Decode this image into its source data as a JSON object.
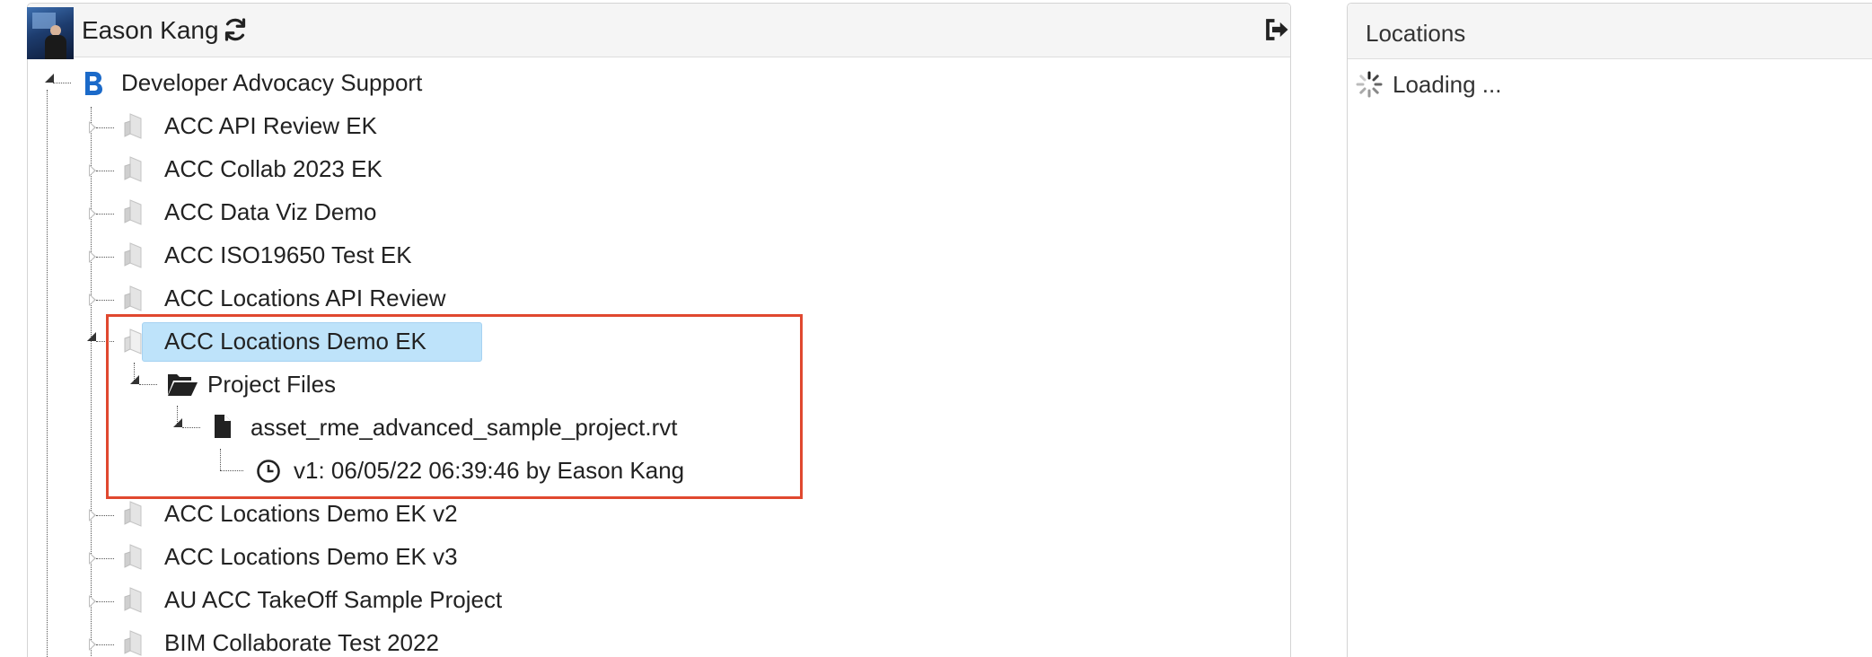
{
  "header": {
    "user_name": "Eason Kang",
    "refresh_icon": "refresh-icon",
    "signout_icon": "sign-out-icon"
  },
  "tree": {
    "hub": {
      "label": "Developer Advocacy Support",
      "icon": "bim360-b-icon"
    },
    "projects": [
      {
        "label": "ACC API Review EK"
      },
      {
        "label": "ACC Collab 2023 EK"
      },
      {
        "label": "ACC Data Viz Demo"
      },
      {
        "label": "ACC ISO19650 Test EK"
      },
      {
        "label": "ACC Locations API Review"
      },
      {
        "label": "ACC Locations Demo EK",
        "selected": true,
        "expanded": true
      },
      {
        "label": "ACC Locations Demo EK v2"
      },
      {
        "label": "ACC Locations Demo EK v3"
      },
      {
        "label": "AU ACC TakeOff Sample Project"
      },
      {
        "label": "BIM Collaborate Test 2022"
      }
    ],
    "expanded": {
      "folder": {
        "label": "Project Files",
        "icon": "folder-open-icon"
      },
      "file": {
        "label": "asset_rme_advanced_sample_project.rvt",
        "icon": "file-icon"
      },
      "version": {
        "label": "v1: 06/05/22 06:39:46 by Eason Kang",
        "icon": "clock-icon"
      }
    }
  },
  "locations_panel": {
    "title": "Locations",
    "loading_text": "Loading ..."
  },
  "colors": {
    "selection": "#bee3fa",
    "highlight_border": "#e0482f",
    "bim_blue": "#1b6ac9"
  }
}
